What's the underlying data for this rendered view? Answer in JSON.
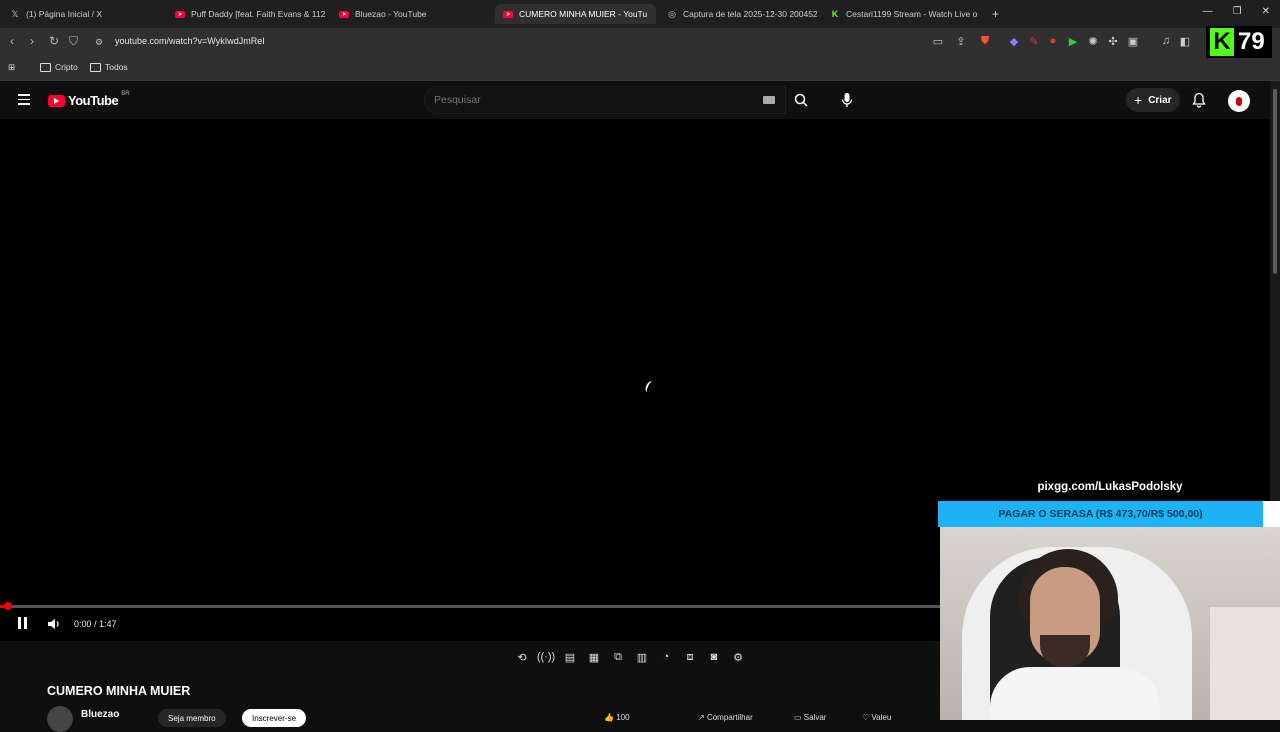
{
  "browser": {
    "tabs": [
      {
        "title": "(1) Página Inicial / X",
        "icon": "x-icon"
      },
      {
        "title": "Puff Daddy [feat. Faith Evans & 112]",
        "icon": "youtube-icon"
      },
      {
        "title": "Bluezao - YouTube",
        "icon": "youtube-icon"
      },
      {
        "title": "CUMERO MINHA MUIER - YouTu",
        "icon": "youtube-icon",
        "active": true
      },
      {
        "title": "Captura de tela 2025-12-30 200452...",
        "icon": "globe-icon"
      },
      {
        "title": "Cestari1199 Stream - Watch Live on I",
        "icon": "kick-icon"
      }
    ],
    "new_tab": "+",
    "url": "youtube.com/watch?v=WykIwdJmReI",
    "bookmarks": [
      "Cripto",
      "Todos"
    ]
  },
  "kick_overlay": {
    "logo": "K",
    "count": "79"
  },
  "youtube": {
    "logo_text": "YouTube",
    "region": "BR",
    "search_placeholder": "Pesquisar",
    "create_label": "Criar"
  },
  "player": {
    "time": "0:00 / 1:47",
    "progress_fraction": 0.005
  },
  "video": {
    "title": "CUMERO MINHA MUIER",
    "channel": "Bluezao",
    "join_label": "Seja membro",
    "subscribe_label": "Inscrever-se",
    "likes": "100",
    "share_label": "Compartilhar",
    "save_label": "Salvar",
    "thanks_label": "Valeu"
  },
  "stream_overlay": {
    "url_text": "pixgg.com/LukasPodolsky",
    "banner_text": "PAGAR O SERASA (R$ 473,70/R$ 500,00)"
  },
  "colors": {
    "accent": "#ff0033",
    "banner": "#1bb3f5",
    "kick_green": "#53fc18"
  }
}
